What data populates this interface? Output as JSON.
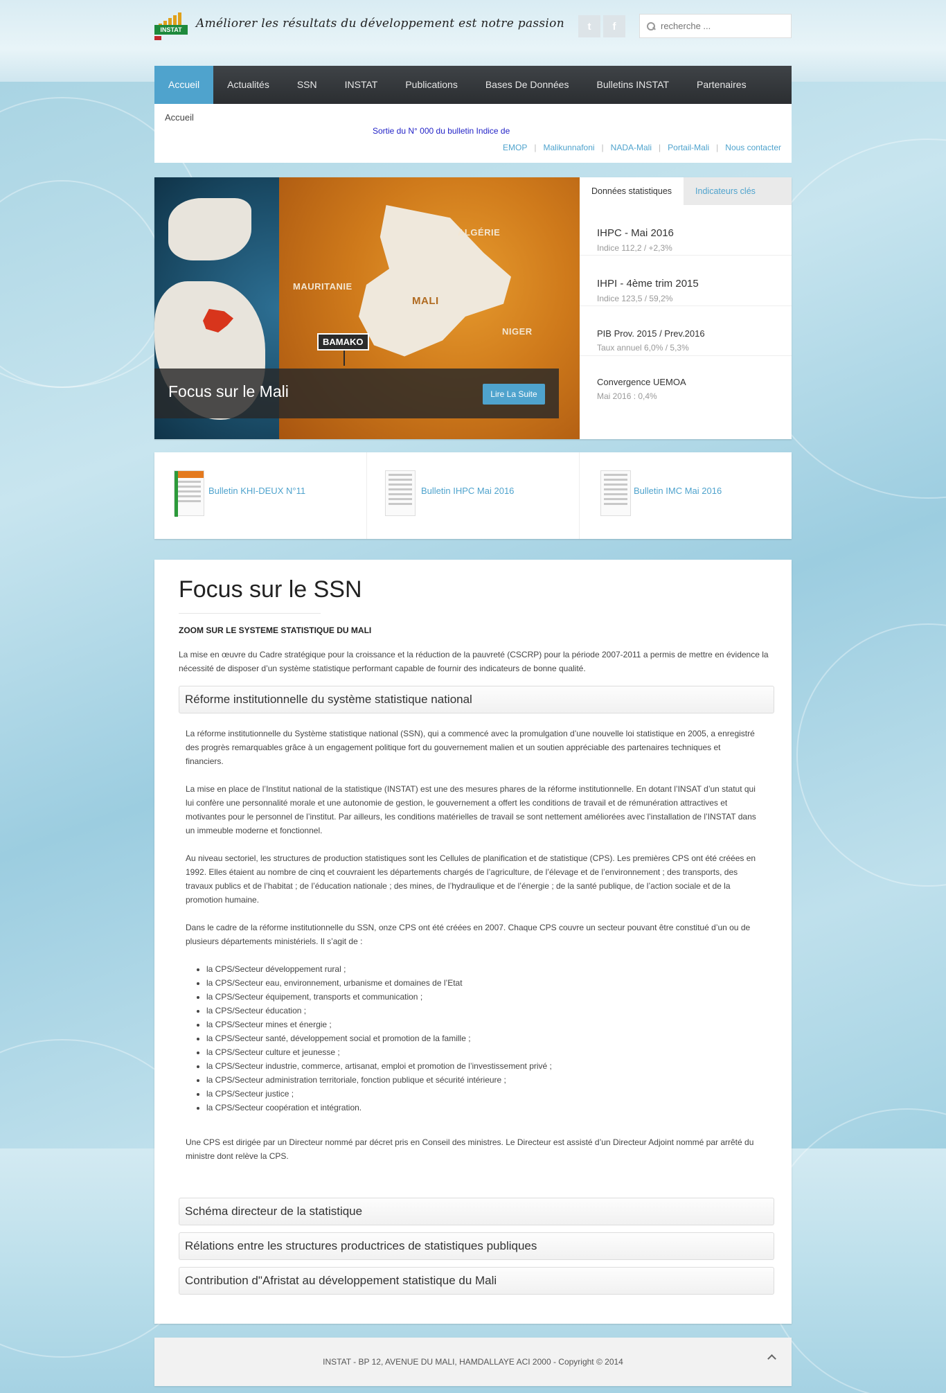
{
  "header": {
    "logo_text": "INSTAT",
    "tagline": "Améliorer les résultats du développement est notre passion",
    "search_placeholder": "recherche ..."
  },
  "nav": {
    "items": [
      {
        "label": "Accueil"
      },
      {
        "label": "Actualités"
      },
      {
        "label": "SSN"
      },
      {
        "label": "INSTAT"
      },
      {
        "label": "Publications"
      },
      {
        "label": "Bases De Données"
      },
      {
        "label": "Bulletins INSTAT"
      },
      {
        "label": "Partenaires"
      }
    ]
  },
  "breadcrumb": {
    "current": "Accueil"
  },
  "ticker": "Sortie du N° 000 du bulletin Indice de",
  "quicklinks": [
    "EMOP",
    "Malikunnafoni",
    "NADA-Mali",
    "Portail-Mali",
    "Nous contacter"
  ],
  "hero": {
    "map_labels": {
      "algerie": "ALGÉRIE",
      "mauritanie": "MAURITANIE",
      "mali": "MALI",
      "niger": "NIGER",
      "bamako": "BAMAKO"
    },
    "caption_title": "Focus sur le Mali",
    "caption_button": "Lire La Suite",
    "tabs": [
      {
        "label": "Données statistiques"
      },
      {
        "label": "Indicateurs clés"
      }
    ],
    "stats": [
      {
        "title": "IHPC - Mai 2016",
        "sub": "Indice 112,2 / +2,3%"
      },
      {
        "title": "IHPI - 4ème trim 2015",
        "sub": "Indice 123,5 / 59,2%"
      },
      {
        "title": "PIB Prov. 2015 / Prev.2016",
        "sub": "Taux annuel 6,0% / 5,3%"
      },
      {
        "title": "Convergence UEMOA",
        "sub": "Mai 2016 : 0,4%"
      }
    ]
  },
  "bulletins": [
    {
      "label": "Bulletin KHI-DEUX N°11"
    },
    {
      "label": "Bulletin IHPC Mai 2016"
    },
    {
      "label": "Bulletin IMC Mai 2016"
    }
  ],
  "article": {
    "title": "Focus sur le SSN",
    "subhead": "ZOOM SUR LE SYSTEME STATISTIQUE DU MALI",
    "intro": "La mise en œuvre du Cadre stratégique pour la croissance et la réduction de la pauvreté (CSCRP) pour la période 2007-2011 a permis de mettre en évidence la nécessité de disposer d’un système statistique performant capable de fournir des indicateurs de bonne qualité.",
    "sections": [
      {
        "title": "Réforme institutionnelle du système statistique national"
      },
      {
        "title": "Schéma directeur de la statistique"
      },
      {
        "title": "Rélations entre les structures productrices de statistiques publiques"
      },
      {
        "title": "Contribution d\"Afristat au développement statistique du Mali"
      }
    ],
    "paragraphs": [
      "La réforme institutionnelle du Système statistique national (SSN), qui a commencé avec la promulgation d’une nouvelle loi statistique en 2005, a enregistré des progrès remarquables grâce à un engagement politique fort du gouvernement malien et un soutien appréciable des partenaires techniques et financiers.",
      "La mise en place de l’Institut national de la statistique (INSTAT) est une des mesures phares de la réforme institutionnelle. En dotant l’INSAT d’un statut qui lui confère une personnalité morale et une autonomie de gestion, le gouvernement a offert les conditions de travail et de rémunération attractives et motivantes pour le personnel de l’institut. Par ailleurs, les conditions matérielles de travail se sont nettement améliorées avec l’installation de l’INSTAT dans un immeuble moderne et fonctionnel.",
      "Au niveau sectoriel, les structures de production statistiques sont les Cellules de planification et de statistique (CPS). Les premières CPS ont été créées en 1992. Elles étaient au nombre de cinq et couvraient les départements chargés de l’agriculture, de l’élevage et de l’environnement ; des transports, des travaux publics et de l’habitat ; de l’éducation nationale ; des mines, de l’hydraulique et de l’énergie ; de la santé publique, de l’action sociale et de la promotion humaine.",
      "Dans le cadre de la réforme institutionnelle du SSN, onze CPS ont été créées en 2007. Chaque CPS couvre un secteur pouvant être constitué d’un ou de plusieurs départements ministériels. Il s’agit de :"
    ],
    "list": [
      "la CPS/Secteur développement rural ;",
      "la CPS/Secteur eau, environnement, urbanisme et domaines de l’Etat",
      "la CPS/Secteur équipement, transports et communication ;",
      "la CPS/Secteur éducation ;",
      "la CPS/Secteur mines et énergie ;",
      "la CPS/Secteur santé, développement social et promotion de la famille ;",
      "la CPS/Secteur culture et jeunesse ;",
      "la CPS/Secteur industrie, commerce, artisanat, emploi et promotion de l’investissement privé ;",
      "la CPS/Secteur administration territoriale, fonction publique et sécurité intérieure ;",
      "la CPS/Secteur justice ;",
      "la CPS/Secteur coopération et intégration."
    ],
    "closing": "Une CPS est dirigée par un Directeur nommé par décret pris en Conseil des ministres. Le Directeur est assisté d’un Directeur Adjoint nommé par arrêté du ministre dont relève la CPS."
  },
  "footer": {
    "text": "INSTAT - BP 12, AVENUE DU MALI, HAMDALLAYE ACI 2000 - Copyright © 2014"
  },
  "colors": {
    "accent": "#4fa3cd",
    "nav_bg": "#2f3235",
    "ticker": "#2323c7"
  }
}
